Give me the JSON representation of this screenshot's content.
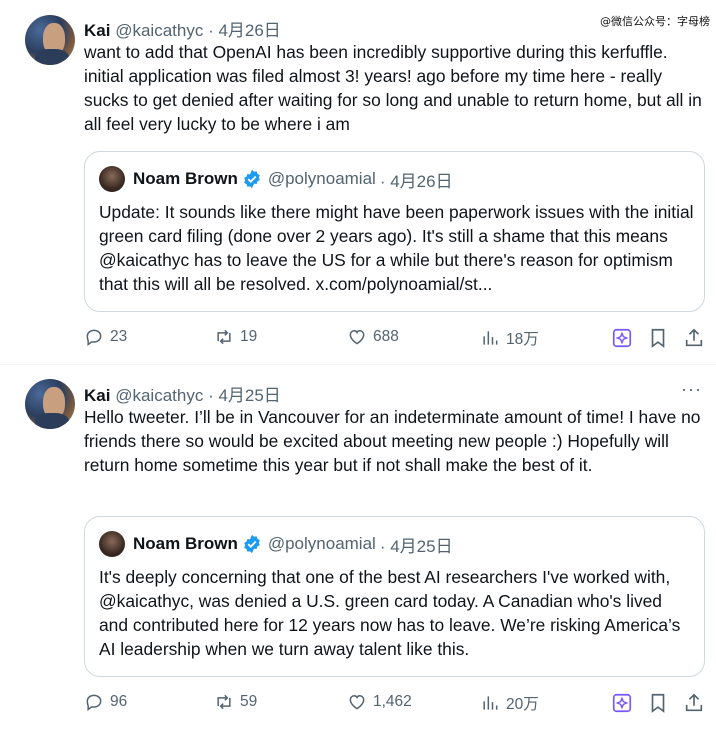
{
  "watermark": "@微信公众号：字母榜",
  "tweets": [
    {
      "name": "Kai",
      "handle": "@kaicathyc",
      "date": "· 4月26日",
      "text": "want to add that OpenAI has been incredibly supportive during this kerfuffle. initial application was filed almost 3! years! ago  before my time here - really sucks to get denied after waiting for so long and unable to return home, but all in all feel very lucky to be where i am",
      "quote": {
        "name": "Noam Brown",
        "handle": "@polynoamial",
        "date": "· 4月26日",
        "text": "Update: It sounds like there might have been paperwork issues with the initial green card filing (done over 2 years ago). It's still a shame that this means @kaicathyc has to leave the US for a while but there's reason for optimism that this will all be resolved. x.com/polynoamial/st..."
      },
      "replies": "23",
      "reposts": "19",
      "likes": "688",
      "views": "18万"
    },
    {
      "name": "Kai",
      "handle": "@kaicathyc",
      "date": "· 4月25日",
      "more": "···",
      "text": "Hello tweeter. I’ll be in Vancouver for an indeterminate amount of time! I have no friends there so would be excited about meeting new people :) Hopefully will return home sometime this year but if not shall make the best of it.",
      "quote": {
        "name": "Noam Brown",
        "handle": "@polynoamial",
        "date": "· 4月25日",
        "text": "It's deeply concerning that one of the best AI researchers I've worked with, @kaicathyc, was denied a U.S. green card today. A Canadian who's lived and contributed here for 12 years now has to leave. We’re risking America’s AI leadership when we turn away talent like this."
      },
      "replies": "96",
      "reposts": "59",
      "likes": "1,462",
      "views": "20万"
    }
  ],
  "colors": {
    "verified": "#1d9bf0",
    "grok": "#7856ff",
    "muted": "#536471",
    "border": "#cfd9de"
  }
}
